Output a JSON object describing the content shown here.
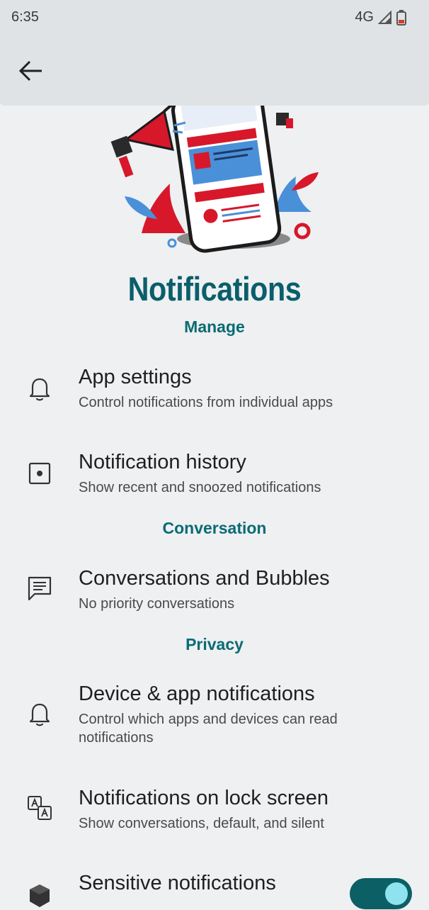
{
  "status_bar": {
    "time": "6:35",
    "network": "4G",
    "icons": [
      "signal-icon",
      "battery-icon"
    ],
    "battery_color": "#d63b2a"
  },
  "app_bar": {
    "back_icon": "arrow-back-icon"
  },
  "page": {
    "title": "Notifications"
  },
  "colors": {
    "accent": "#0b6b73",
    "toggle_on": "#0c5f65",
    "illustration_red": "#d7182a",
    "illustration_blue": "#4a90d9"
  },
  "sections": {
    "manage": "Manage",
    "conversation": "Conversation",
    "privacy": "Privacy"
  },
  "items": {
    "app_settings": {
      "title": "App settings",
      "subtitle": "Control notifications from individual apps",
      "icon": "bell-icon"
    },
    "notification_history": {
      "title": "Notification history",
      "subtitle": "Show recent and snoozed notifications",
      "icon": "history-box-icon"
    },
    "conversations": {
      "title": "Conversations and Bubbles",
      "subtitle": "No priority conversations",
      "icon": "chat-bubble-icon"
    },
    "device_app_notifications": {
      "title": "Device & app notifications",
      "subtitle": "Control which apps and devices can read notifications",
      "icon": "bell-icon"
    },
    "lock_screen": {
      "title": "Notifications on lock screen",
      "subtitle": "Show conversations, default, and silent",
      "icon": "translate-icon"
    },
    "sensitive": {
      "title": "Sensitive notifications",
      "icon": "cube-icon",
      "toggle_on": true
    }
  }
}
